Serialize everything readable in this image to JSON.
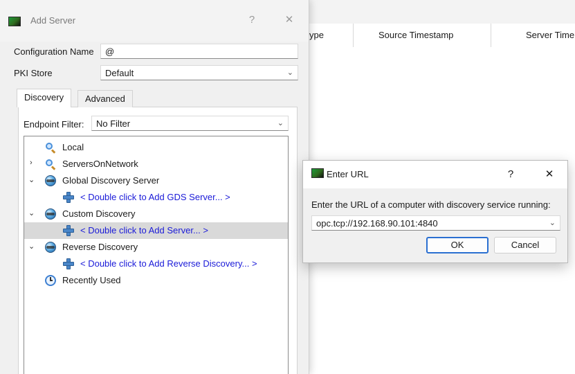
{
  "background": {
    "columns": [
      "ype",
      "Source Timestamp",
      "Server Time"
    ]
  },
  "add_server": {
    "title": "Add Server",
    "help_btn": "?",
    "close_btn": "✕",
    "config_name_label": "Configuration Name",
    "config_name_value": "@",
    "pki_label": "PKI Store",
    "pki_value": "Default",
    "tabs": [
      "Discovery",
      "Advanced"
    ],
    "endpoint_filter_label": "Endpoint Filter:",
    "endpoint_filter_value": "No Filter",
    "tree": [
      {
        "label": "Local"
      },
      {
        "label": "ServersOnNetwork"
      },
      {
        "label": "Global Discovery Server"
      },
      {
        "label": "< Double click to Add GDS Server... >"
      },
      {
        "label": "Custom Discovery"
      },
      {
        "label": "< Double click to Add Server... >"
      },
      {
        "label": "Reverse Discovery"
      },
      {
        "label": "< Double click to Add Reverse Discovery... >"
      },
      {
        "label": "Recently Used"
      }
    ]
  },
  "enter_url": {
    "title": "Enter URL",
    "help_btn": "?",
    "close_btn": "✕",
    "prompt": "Enter the URL of a computer with discovery service running:",
    "url_value": "opc.tcp://192.168.90.101:4840",
    "ok_label": "OK",
    "cancel_label": "Cancel"
  },
  "colors": {
    "link": "#1a1ad8",
    "selected_row": "#d9d9d9",
    "default_button_border": "#2a6fd1"
  }
}
